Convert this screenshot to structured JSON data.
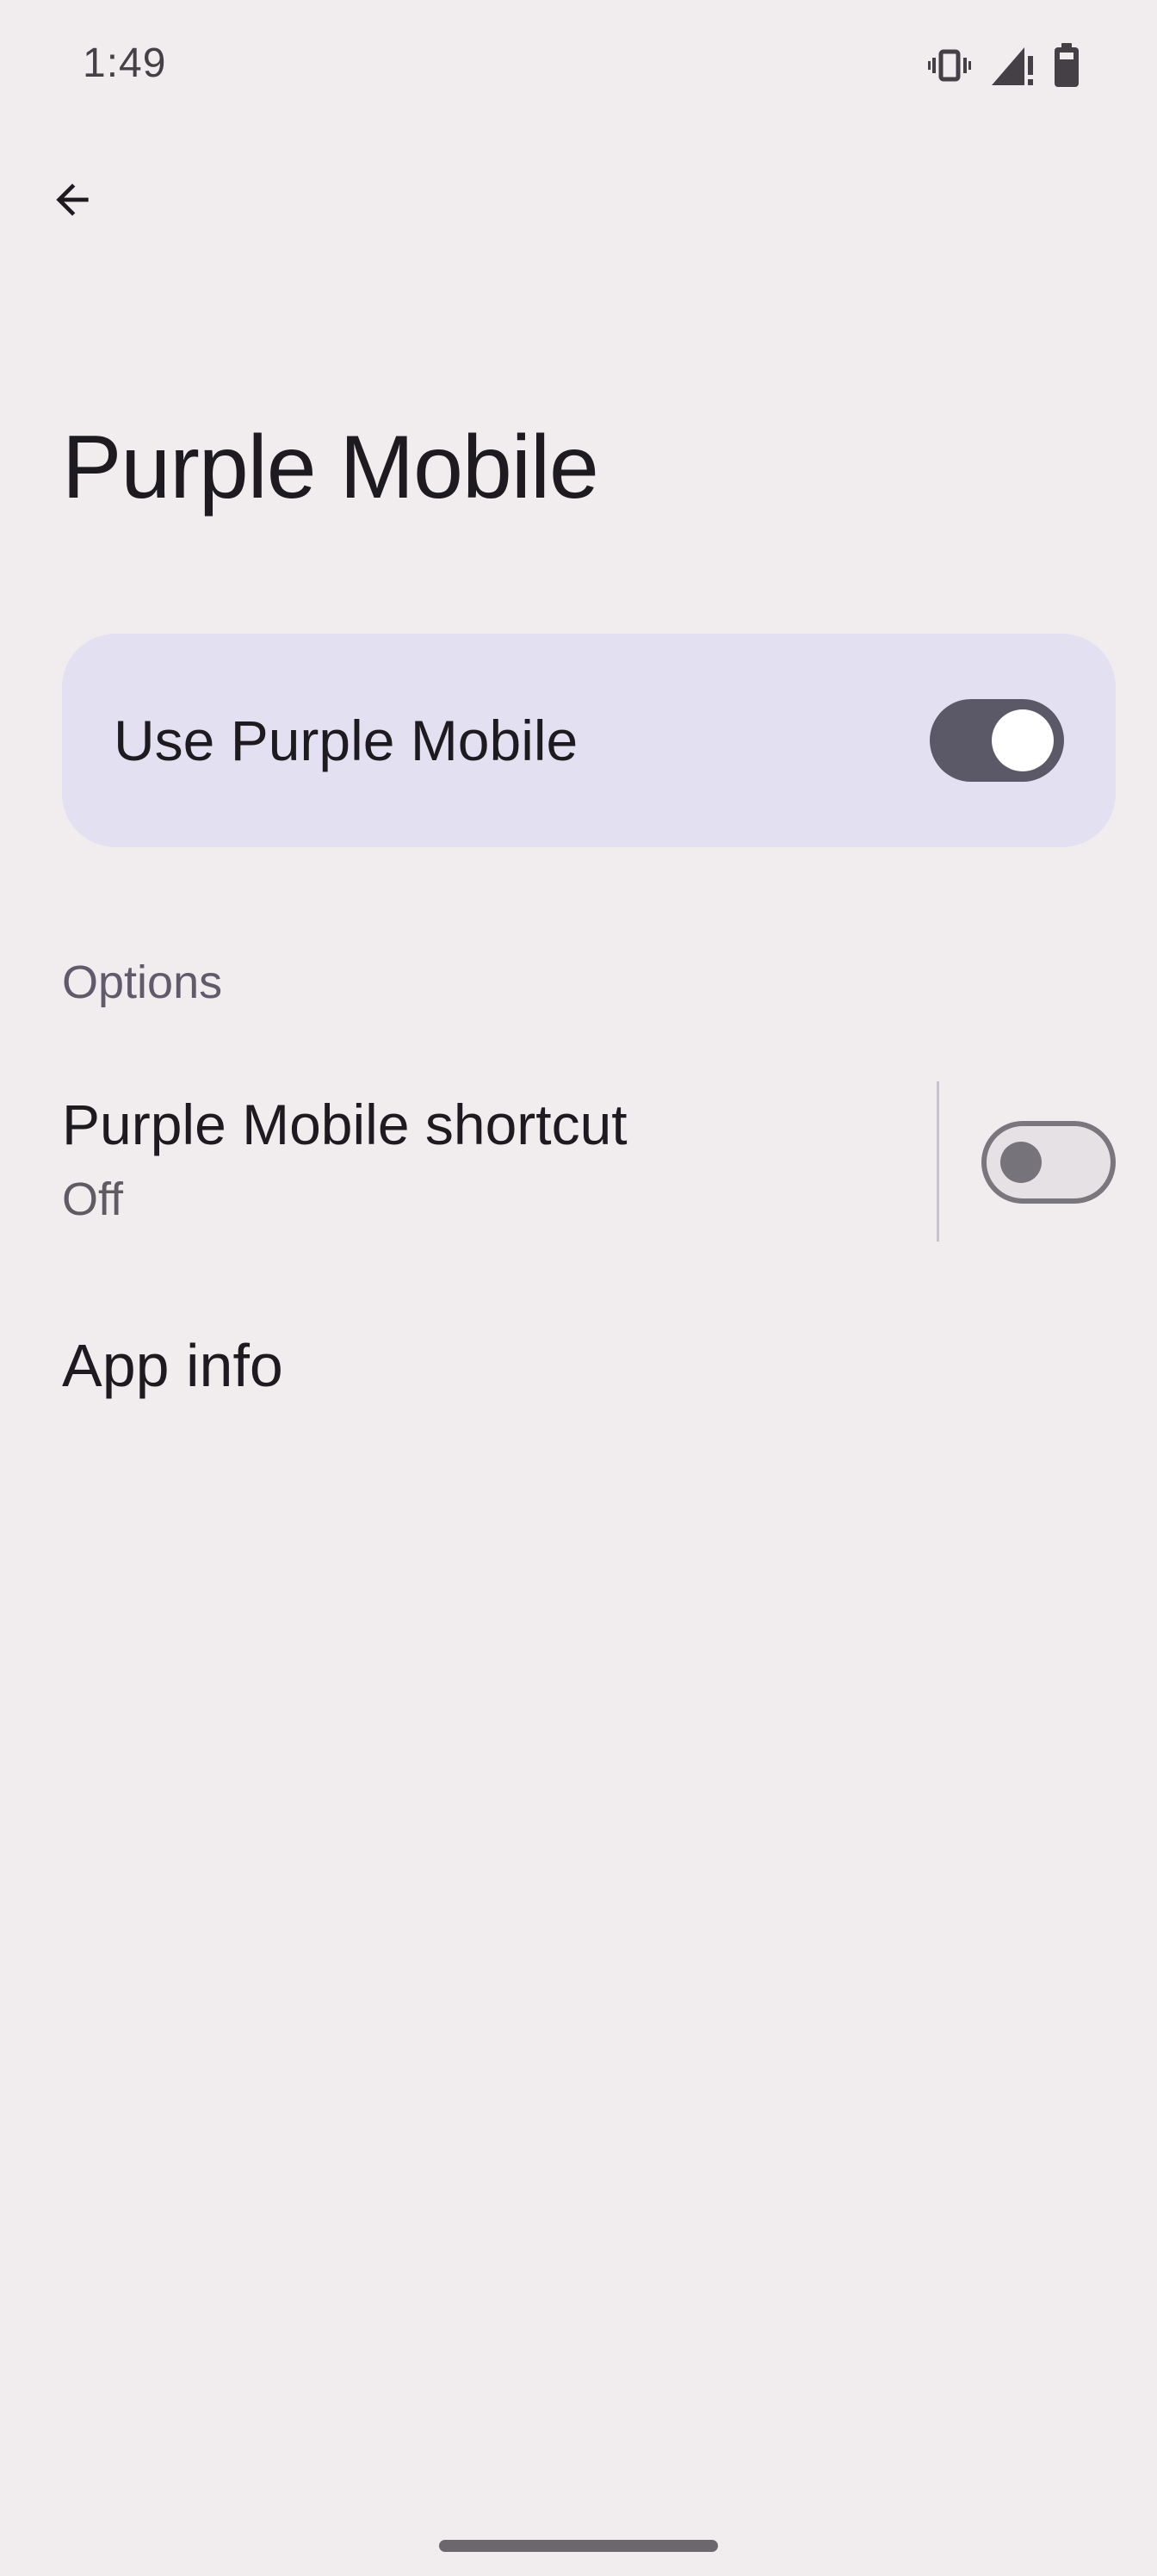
{
  "status_bar": {
    "time": "1:49",
    "icons": [
      "vibrate-icon",
      "signal-no-service-icon",
      "battery-icon"
    ]
  },
  "app_bar": {
    "back_icon": "arrow-back-icon"
  },
  "page": {
    "title": "Purple Mobile"
  },
  "main_switch": {
    "label": "Use Purple Mobile",
    "checked": true,
    "accent_color": "#e3e0f2",
    "track_color": "#5b5968"
  },
  "options_section": {
    "header": "Options",
    "shortcut": {
      "title": "Purple Mobile shortcut",
      "summary": "Off",
      "checked": false
    },
    "app_info": {
      "label": "App info"
    }
  },
  "colors": {
    "background": "#f1edee",
    "text_primary": "#1d1b20",
    "text_secondary": "#5f5b6a"
  }
}
